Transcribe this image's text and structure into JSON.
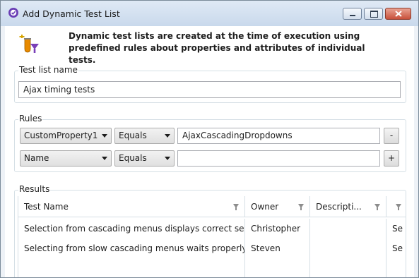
{
  "window": {
    "title": "Add Dynamic Test List"
  },
  "header": {
    "description": "Dynamic test lists are created at the time of execution using predefined rules about properties and attributes of individual tests."
  },
  "test_list_name": {
    "legend": "Test list name",
    "value": "Ajax timing tests"
  },
  "rules": {
    "legend": "Rules",
    "rows": [
      {
        "property": "CustomProperty1",
        "operator": "Equals",
        "value": "AjaxCascadingDropdowns",
        "button": "-"
      },
      {
        "property": "Name",
        "operator": "Equals",
        "value": "",
        "button": "+"
      }
    ]
  },
  "results": {
    "legend": "Results",
    "columns": [
      "Test Name",
      "Owner",
      "Descripti...",
      ""
    ],
    "rows": [
      {
        "test_name": "Selection from cascading menus displays correct selection",
        "owner": "Christopher",
        "description": "",
        "extra": "Se"
      },
      {
        "test_name": "Selecting from slow cascading menus waits properly",
        "owner": "Steven",
        "description": "",
        "extra": "Se"
      }
    ]
  }
}
